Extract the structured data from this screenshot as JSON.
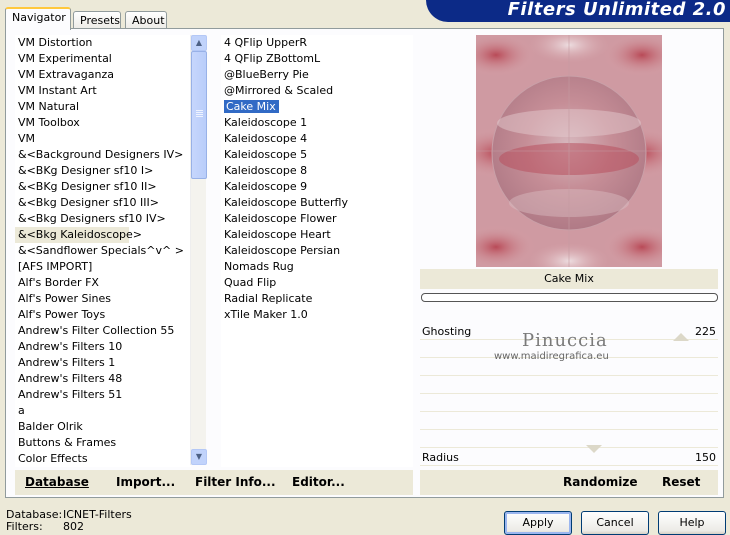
{
  "tabs": [
    "Navigator",
    "Presets",
    "About"
  ],
  "banner": "Filters Unlimited 2.0",
  "categories": [
    "VM Distortion",
    "VM Experimental",
    "VM Extravaganza",
    "VM Instant Art",
    "VM Natural",
    "VM Toolbox",
    "VM",
    "&<Background Designers IV>",
    "&<BKg Designer sf10 I>",
    "&<BKg Designer sf10 II>",
    "&<Bkg Designer sf10 III>",
    "&<Bkg Designers sf10 IV>",
    "&<Bkg Kaleidoscope>",
    "&<Sandflower Specials^v^ >",
    "[AFS IMPORT]",
    "Alf's Border FX",
    "Alf's Power Sines",
    "Alf's Power Toys",
    "Andrew's Filter Collection 55",
    "Andrew's Filters 10",
    "Andrew's Filters 1",
    "Andrew's Filters 48",
    "Andrew's Filters 51",
    "a",
    "Balder Olrik",
    "Buttons & Frames",
    "Color Effects"
  ],
  "filters": [
    "4 QFlip UpperR",
    "4 QFlip ZBottomL",
    "@BlueBerry Pie",
    "@Mirrored & Scaled",
    "Cake Mix",
    "Kaleidoscope 1",
    "Kaleidoscope 4",
    "Kaleidoscope 5",
    "Kaleidoscope 8",
    "Kaleidoscope 9",
    "Kaleidoscope Butterfly",
    "Kaleidoscope Flower",
    "Kaleidoscope Heart",
    "Kaleidoscope Persian",
    "Nomads Rug",
    "Quad Flip",
    "Radial Replicate",
    "xTile Maker 1.0"
  ],
  "left_buttons": {
    "database": "Database",
    "import": "Import...",
    "filter_info": "Filter Info...",
    "editor": "Editor..."
  },
  "filter_name": "Cake Mix",
  "sliders": {
    "ghosting_label": "Ghosting",
    "ghosting_value": "225",
    "radius_label": "Radius",
    "radius_value": "150"
  },
  "watermark": {
    "name": "Pinuccia",
    "site": "www.maidiregrafica.eu"
  },
  "right_buttons": {
    "randomize": "Randomize",
    "reset": "Reset"
  },
  "status": {
    "db_label": "Database:",
    "db_value": "ICNET-Filters",
    "filters_label": "Filters:",
    "filters_value": "802"
  },
  "dialog_buttons": {
    "apply": "Apply",
    "cancel": "Cancel",
    "help": "Help"
  }
}
